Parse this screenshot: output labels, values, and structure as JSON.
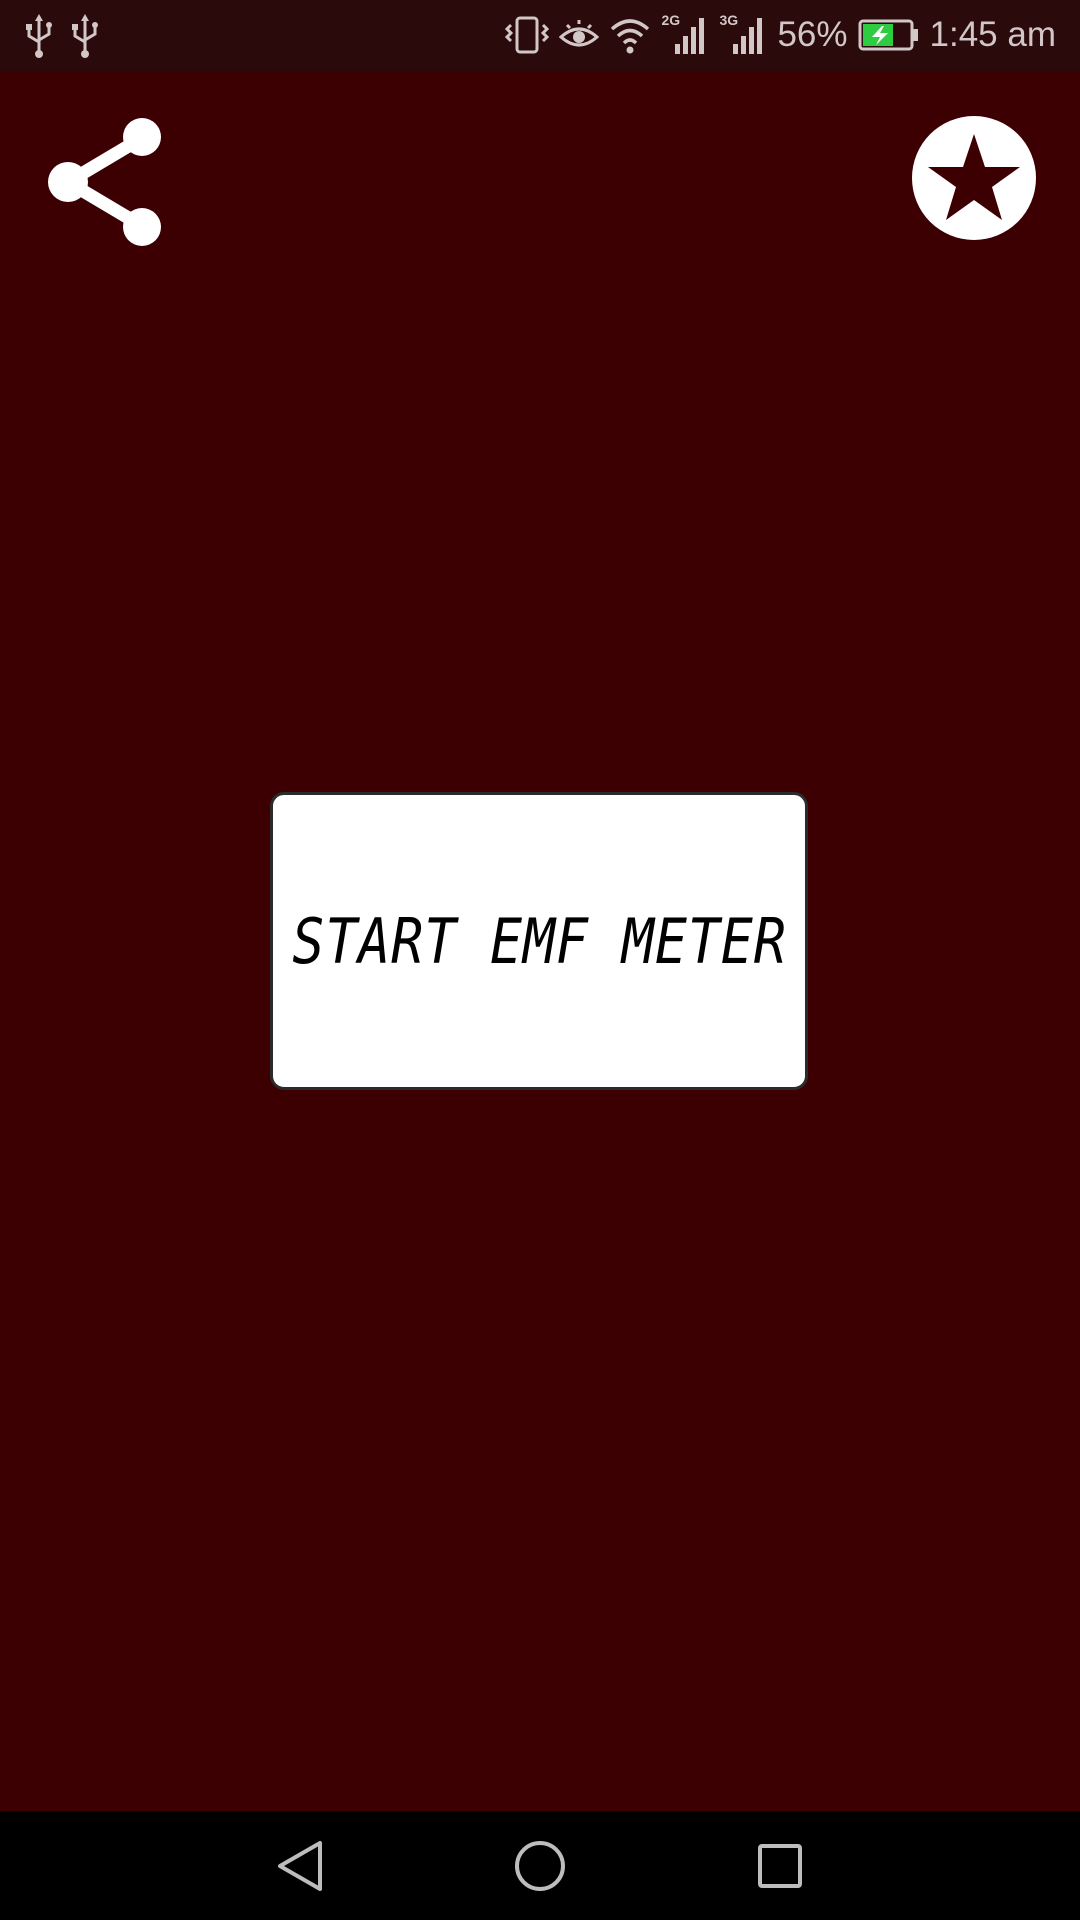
{
  "status_bar": {
    "battery_percent": "56%",
    "time": "1:45 am",
    "net_type_1": "2G",
    "net_type_2": "3G",
    "icons": [
      "usb-icon",
      "usb-icon",
      "vibrate-icon",
      "eye-comfort-icon",
      "wifi-icon",
      "signal-icon",
      "signal-icon",
      "battery-charging-icon"
    ]
  },
  "toolbar": {
    "share_icon": "share-icon",
    "rate_icon": "star-icon"
  },
  "main": {
    "start_label": "START EMF METER"
  },
  "nav_bar": {
    "icons": [
      "back-icon",
      "home-icon",
      "recents-icon"
    ]
  },
  "colors": {
    "background": "#3c0003",
    "status_bar": "#2a0a0b",
    "nav_bar": "#000000",
    "button_bg": "#ffffff",
    "button_text": "#000000",
    "battery_fill": "#2ecc40"
  }
}
